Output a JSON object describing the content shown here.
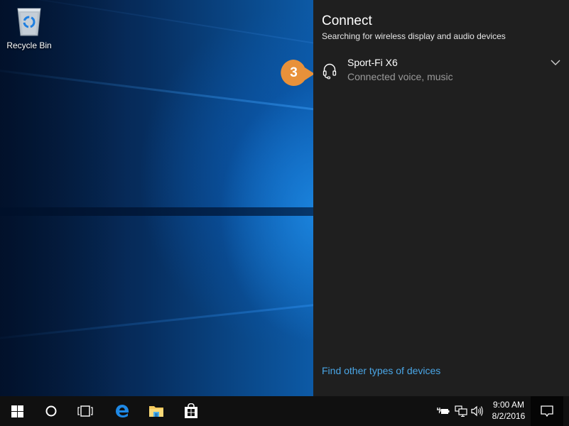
{
  "desktop": {
    "icons": [
      {
        "label": "Recycle Bin",
        "icon": "recycle-bin-icon"
      }
    ]
  },
  "callout": {
    "number": "3",
    "color": "#e8913a"
  },
  "connect_panel": {
    "title": "Connect",
    "subtitle": "Searching for wireless display and audio devices",
    "devices": [
      {
        "name": "Sport-Fi X6",
        "status": "Connected voice, music",
        "icon": "headset-icon",
        "expand_icon": "chevron-down-icon"
      }
    ],
    "find_link": "Find other types of devices",
    "link_color": "#4aa6e6",
    "background": "#1f1f1f"
  },
  "taskbar": {
    "buttons": [
      {
        "name": "start",
        "icon": "windows-logo-icon"
      },
      {
        "name": "cortana",
        "icon": "cortana-circle-icon"
      },
      {
        "name": "task-view",
        "icon": "task-view-icon"
      },
      {
        "name": "edge",
        "icon": "edge-browser-icon"
      },
      {
        "name": "file-explorer",
        "icon": "folder-icon"
      },
      {
        "name": "store",
        "icon": "store-bag-icon"
      }
    ],
    "tray": [
      {
        "name": "power",
        "icon": "battery-plug-icon"
      },
      {
        "name": "network",
        "icon": "network-icon"
      },
      {
        "name": "volume",
        "icon": "speaker-icon"
      }
    ],
    "clock": {
      "time": "9:00 AM",
      "date": "8/2/2016"
    },
    "action_center_icon": "action-center-icon"
  }
}
